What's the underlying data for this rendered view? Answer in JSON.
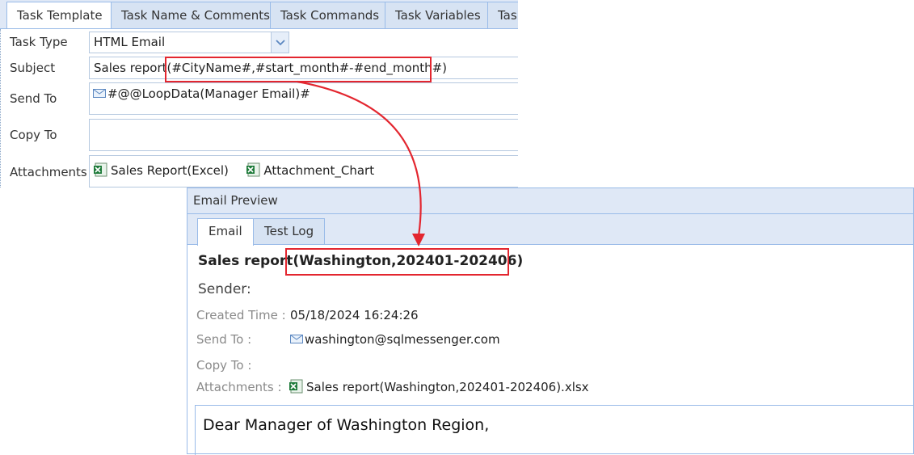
{
  "editor": {
    "tabs": [
      {
        "label": "Task Template"
      },
      {
        "label": "Task Name & Comments"
      },
      {
        "label": "Task Commands"
      },
      {
        "label": "Task Variables"
      },
      {
        "label": "Task"
      }
    ],
    "task_type_label": "Task Type",
    "task_type_value": "HTML Email",
    "subject_label": "Subject",
    "subject_prefix": "Sales report",
    "subject_highlight": "(#CityName#,#start_month#-#end_month#)",
    "send_to_label": "Send To",
    "send_to_value": "#@@LoopData(Manager Email)#",
    "copy_to_label": "Copy To",
    "copy_to_value": "",
    "attachments_label": "Attachments",
    "attachments": [
      "Sales Report(Excel)",
      "Attachment_Chart"
    ]
  },
  "preview": {
    "title": "Email Preview",
    "tabs": [
      {
        "label": "Email"
      },
      {
        "label": "Test Log"
      }
    ],
    "subject_prefix": "Sales report",
    "subject_highlight": "(Washington,202401-202406)",
    "sender_label": "Sender:",
    "created_time_label": "Created Time :",
    "created_time_value": "05/18/2024 16:24:26",
    "send_to_label": "Send To :",
    "send_to_value": "washington@sqlmessenger.com",
    "copy_to_label": "Copy To :",
    "attachments_label": "Attachments :",
    "attachment_file": "Sales report(Washington,202401-202406).xlsx",
    "body_text": "Dear Manager of  Washington  Region,"
  },
  "colors": {
    "highlight": "#e3262f",
    "panel_header": "#dfe8f6",
    "border": "#99bbe8"
  }
}
